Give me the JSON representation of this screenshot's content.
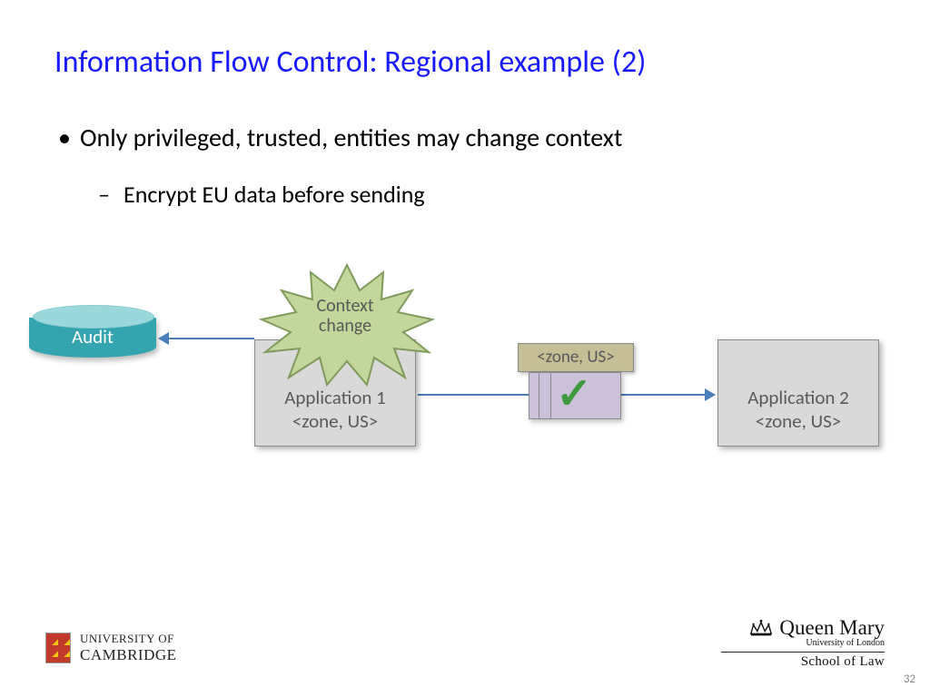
{
  "title": "Information Flow Control: Regional example (2)",
  "bullets": {
    "lvl1": "Only privileged, trusted, entities may change context",
    "lvl2": "Encrypt EU data before sending"
  },
  "diagram": {
    "audit_label": "Audit",
    "context_change": "Context\nchange",
    "app1": {
      "name": "Application 1",
      "tag": "<zone, US>"
    },
    "app2": {
      "name": "Application 2",
      "tag": "<zone, US>"
    },
    "packet_tag": "<zone, US>",
    "checkmark": "✓"
  },
  "footer": {
    "cambridge_line1": "UNIVERSITY OF",
    "cambridge_line2": "CAMBRIDGE",
    "qm_name": "Queen Mary",
    "qm_sub": "University of London",
    "qm_school": "School of Law"
  },
  "page_number": "32"
}
